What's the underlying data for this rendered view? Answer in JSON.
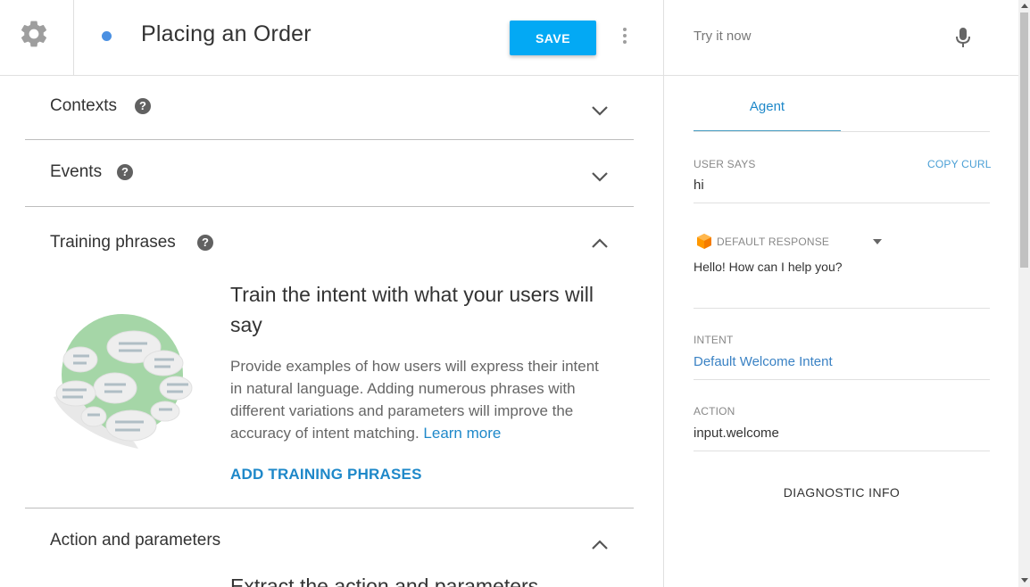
{
  "header": {
    "intent_title": "Placing an Order",
    "save_label": "SAVE"
  },
  "sections": {
    "contexts": {
      "title": "Contexts",
      "help": "?"
    },
    "events": {
      "title": "Events",
      "help": "?"
    },
    "training": {
      "title": "Training phrases",
      "help": "?",
      "heading": "Train the intent with what your users will say",
      "description": "Provide examples of how users will express their intent in natural language. Adding numerous phrases with different variations and parameters will improve the accuracy of intent matching.",
      "learn_more": "Learn more",
      "add_button": "ADD TRAINING PHRASES"
    },
    "action": {
      "title": "Action and parameters",
      "partial_heading": "Extract the action and parameters"
    }
  },
  "try_panel": {
    "placeholder": "Try it now",
    "tab": "Agent",
    "user_says_label": "USER SAYS",
    "copy_curl": "COPY CURL",
    "user_says_value": "hi",
    "default_response_label": "DEFAULT RESPONSE",
    "default_response_value": "Hello! How can I help you?",
    "intent_label": "INTENT",
    "intent_value": "Default Welcome Intent",
    "action_label": "ACTION",
    "action_value": "input.welcome",
    "diagnostic": "DIAGNOSTIC INFO"
  },
  "colors": {
    "accent": "#03a9f4",
    "link": "#1e88c9",
    "dot": "#4a90e2"
  },
  "icons": [
    "gear-icon",
    "more-vert-icon",
    "mic-icon",
    "help-icon",
    "chevron-down-icon",
    "chevron-up-icon",
    "cube-icon",
    "dropdown-caret-icon"
  ]
}
